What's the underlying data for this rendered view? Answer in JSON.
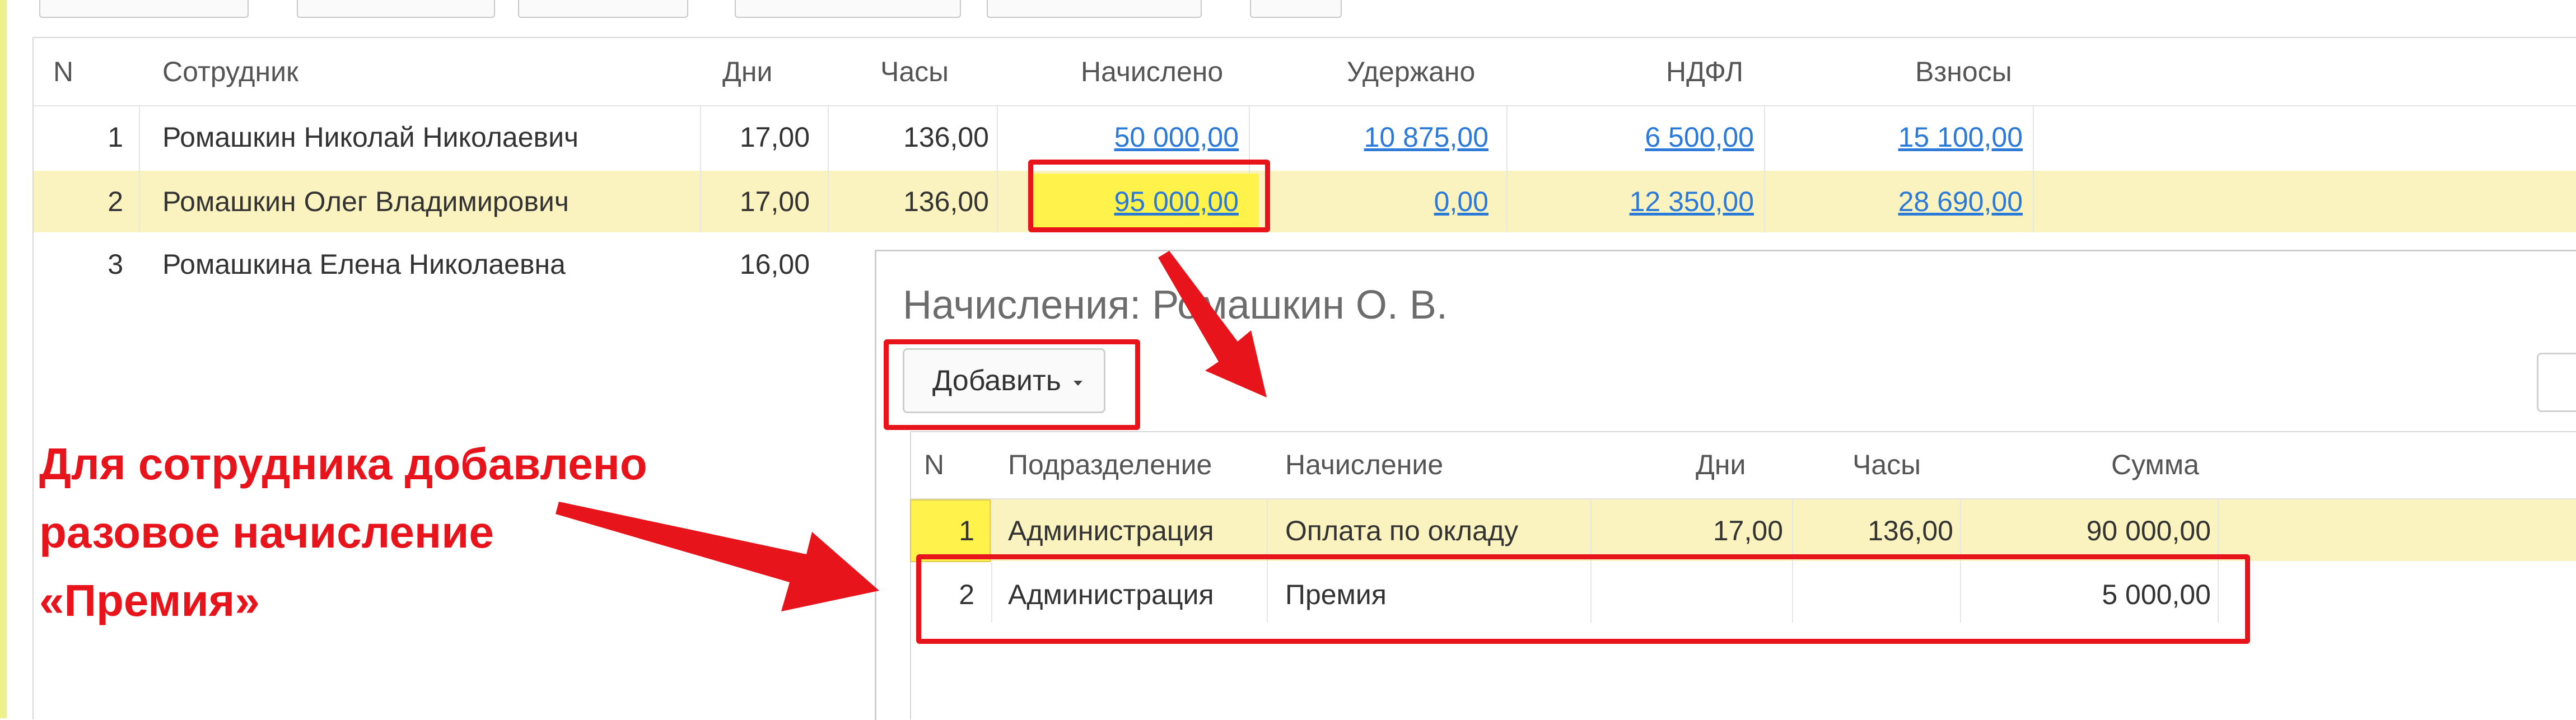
{
  "main_table": {
    "headers": {
      "n": "N",
      "employee": "Сотрудник",
      "days": "Дни",
      "hours": "Часы",
      "accrued": "Начислено",
      "withheld": "Удержано",
      "ndfl": "НДФЛ",
      "contributions": "Взносы"
    },
    "rows": [
      {
        "n": "1",
        "employee": "Ромашкин Николай Николаевич",
        "days": "17,00",
        "hours": "136,00",
        "accrued": "50 000,00",
        "withheld": "10 875,00",
        "ndfl": "6 500,00",
        "contributions": "15 100,00"
      },
      {
        "n": "2",
        "employee": "Ромашкин Олег Владимирович",
        "days": "17,00",
        "hours": "136,00",
        "accrued": "95 000,00",
        "withheld": "0,00",
        "ndfl": "12 350,00",
        "contributions": "28 690,00"
      },
      {
        "n": "3",
        "employee": "Ромашкина Елена Николаевна",
        "days": "16,00"
      }
    ]
  },
  "accruals_panel": {
    "title": "Начисления: Ромашкин О. В.",
    "add_button": "Добавить",
    "headers": {
      "n": "N",
      "department": "Подразделение",
      "accrual": "Начисление",
      "days": "Дни",
      "hours": "Часы",
      "amount": "Сумма"
    },
    "rows": [
      {
        "n": "1",
        "department": "Администрация",
        "accrual": "Оплата по окладу",
        "days": "17,00",
        "hours": "136,00",
        "amount": "90 000,00"
      },
      {
        "n": "2",
        "department": "Администрация",
        "accrual": "Премия",
        "amount": "5 000,00"
      }
    ]
  },
  "annotation": {
    "lines": [
      "Для сотрудника добавлено",
      "разовое начисление",
      "«Премия»"
    ],
    "color": "#e8141c"
  },
  "colors": {
    "row_highlight": "#fbf3bf",
    "cell_highlight": "#fff24a",
    "link": "#2b79d9"
  }
}
